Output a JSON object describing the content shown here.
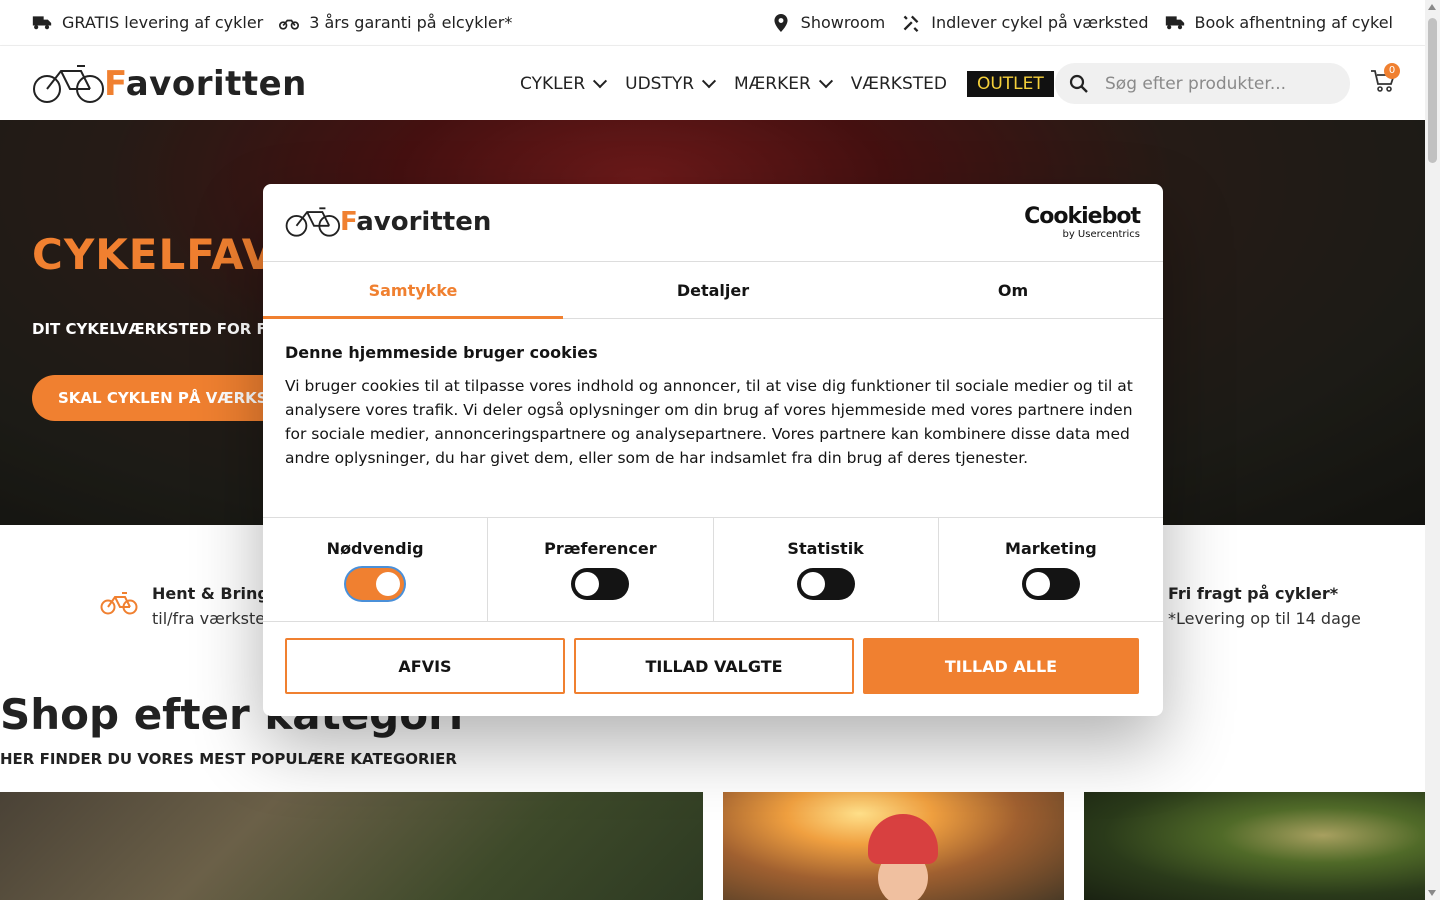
{
  "topbar": {
    "left": [
      {
        "icon": "truck-icon",
        "label": "GRATIS levering af cykler"
      },
      {
        "icon": "motorbike-icon",
        "label": "3 års garanti på elcykler*"
      }
    ],
    "right": [
      {
        "icon": "map-pin-icon",
        "label": "Showroom"
      },
      {
        "icon": "tools-icon",
        "label": "Indlever cykel på værksted"
      },
      {
        "icon": "truck-icon",
        "label": "Book afhentning af cykel"
      }
    ]
  },
  "header": {
    "logo_word_start": "F",
    "logo_word_rest": "avoritten",
    "nav": [
      {
        "label": "CYKLER",
        "dropdown": true
      },
      {
        "label": "UDSTYR",
        "dropdown": true
      },
      {
        "label": "MÆRKER",
        "dropdown": true
      },
      {
        "label": "VÆRKSTED",
        "dropdown": false
      },
      {
        "label": "OUTLET",
        "dropdown": false
      }
    ],
    "search_placeholder": "Søg efter produkter...",
    "cart_count": "0"
  },
  "hero": {
    "title": "CYKELFAVO",
    "subtitle": "DIT CYKELVÆRKSTED FOR FRE",
    "cta": "SKAL CYKLEN PÅ VÆRKSTE"
  },
  "features": {
    "left": {
      "title": "Hent & Bring",
      "text": "til/fra værkste"
    },
    "right": {
      "title": "Fri fragt på cykler*",
      "text": "*Levering op til 14 dage"
    }
  },
  "shop": {
    "title": "Shop efter kategori",
    "subtitle": "HER FINDER DU VORES MEST POPULÆRE KATEGORIER"
  },
  "cookie": {
    "brand": "Cookiebot",
    "brand_by": "by Usercentrics",
    "tabs": [
      "Samtykke",
      "Detaljer",
      "Om"
    ],
    "active_tab": "Samtykke",
    "heading": "Denne hjemmeside bruger cookies",
    "body": "Vi bruger cookies til at tilpasse vores indhold og annoncer, til at vise dig funktioner til sociale medier og til at analysere vores trafik. Vi deler også oplysninger om din brug af vores hjemmeside med vores partnere inden for sociale medier, annonceringspartnere og analysepartnere. Vores partnere kan kombinere disse data med andre oplysninger, du har givet dem, eller som de har indsamlet fra din brug af deres tjenester.",
    "toggles": [
      {
        "label": "Nødvendig",
        "on": true
      },
      {
        "label": "Præferencer",
        "on": false
      },
      {
        "label": "Statistik",
        "on": false
      },
      {
        "label": "Marketing",
        "on": false
      }
    ],
    "buttons": {
      "reject": "AFVIS",
      "allow_selected": "TILLAD VALGTE",
      "allow_all": "TILLAD ALLE"
    }
  },
  "colors": {
    "accent": "#f08030",
    "dark": "#141414",
    "outlet_text": "#f5d03a"
  }
}
